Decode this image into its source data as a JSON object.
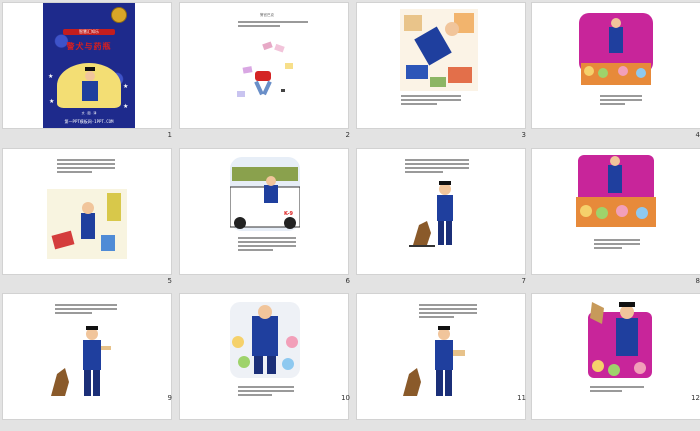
{
  "slides": [
    {
      "number": "1",
      "kind": "cover",
      "cover": {
        "subtitle": "智慧汇知乐",
        "title": "警犬与药瓶",
        "credit": "文 · 图 · 译",
        "footer": "第一PPT模板网-1PPT.COM"
      }
    },
    {
      "number": "2",
      "kind": "text-illustration",
      "heading": "警官巴克"
    },
    {
      "number": "3",
      "kind": "illustration"
    },
    {
      "number": "4",
      "kind": "illustration"
    },
    {
      "number": "5",
      "kind": "illustration"
    },
    {
      "number": "6",
      "kind": "illustration",
      "badge": "K-9"
    },
    {
      "number": "7",
      "kind": "illustration"
    },
    {
      "number": "8",
      "kind": "illustration"
    },
    {
      "number": "9",
      "kind": "illustration"
    },
    {
      "number": "10",
      "kind": "illustration"
    },
    {
      "number": "11",
      "kind": "illustration"
    },
    {
      "number": "12",
      "kind": "illustration"
    }
  ],
  "colors": {
    "background": "#e3e3e3",
    "slide": "#ffffff",
    "police_blue": "#1f3f9e",
    "stage_pink": "#c8259a",
    "cover_navy": "#1e2a8c"
  }
}
